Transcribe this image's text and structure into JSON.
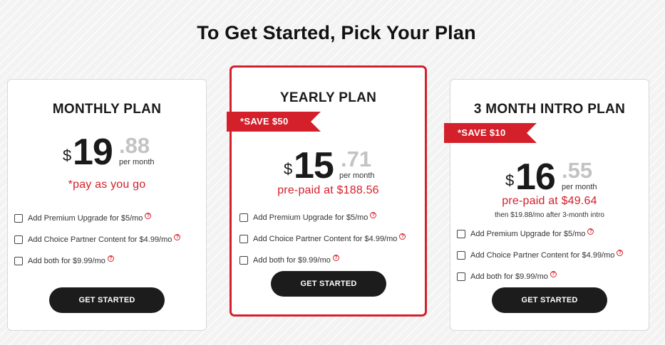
{
  "page": {
    "heading": "To Get Started, Pick Your Plan"
  },
  "colors": {
    "accent": "#d4202a",
    "button": "#1c1c1c",
    "cents": "#c3c3c3"
  },
  "plans": [
    {
      "title": "MONTHLY PLAN",
      "currency": "$",
      "dollars": "19",
      "cents": ".88",
      "per": "per month",
      "subtitle": "*pay as you go",
      "addons": [
        "Add Premium Upgrade for $5/mo",
        "Add Choice Partner Content for $4.99/mo",
        "Add both for $9.99/mo"
      ],
      "cta": "GET STARTED"
    },
    {
      "title": "YEARLY PLAN",
      "badge": "*SAVE $50",
      "currency": "$",
      "dollars": "15",
      "cents": ".71",
      "per": "per month",
      "subtitle": "pre-paid at $188.56",
      "addons": [
        "Add Premium Upgrade for $5/mo",
        "Add Choice Partner Content for $4.99/mo",
        "Add both for $9.99/mo"
      ],
      "cta": "GET STARTED"
    },
    {
      "title": "3 MONTH INTRO PLAN",
      "badge": "*SAVE $10",
      "currency": "$",
      "dollars": "16",
      "cents": ".55",
      "per": "per month",
      "subtitle": "pre-paid at $49.64",
      "note": "then $19.88/mo after 3-month intro",
      "addons": [
        "Add Premium Upgrade for $5/mo",
        "Add Choice Partner Content for $4.99/mo",
        "Add both for $9.99/mo"
      ],
      "cta": "GET STARTED"
    }
  ],
  "icons": {
    "help": "question-circle-icon",
    "check": "checkbox"
  }
}
